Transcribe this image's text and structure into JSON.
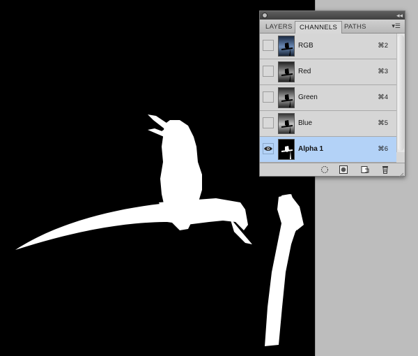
{
  "panel": {
    "tabs": [
      {
        "label": "LAYERS",
        "active": false
      },
      {
        "label": "CHANNELS",
        "active": true
      },
      {
        "label": "PATHS",
        "active": false
      }
    ],
    "menu_icon": "panel-menu-icon",
    "collapse_icon": "collapse-icon",
    "channels": [
      {
        "name": "RGB",
        "shortcut": "⌘2",
        "visible": false,
        "selected": false
      },
      {
        "name": "Red",
        "shortcut": "⌘3",
        "visible": false,
        "selected": false
      },
      {
        "name": "Green",
        "shortcut": "⌘4",
        "visible": false,
        "selected": false
      },
      {
        "name": "Blue",
        "shortcut": "⌘5",
        "visible": false,
        "selected": false
      },
      {
        "name": "Alpha 1",
        "shortcut": "⌘6",
        "visible": true,
        "selected": true
      }
    ],
    "footer_icons": [
      "load-selection-icon",
      "save-selection-icon",
      "new-channel-icon",
      "delete-channel-icon"
    ]
  },
  "colors": {
    "canvas": "#000000",
    "pasteboard": "#bdbdbd",
    "selection": "#b3d2f7",
    "artwork": "#ffffff"
  }
}
